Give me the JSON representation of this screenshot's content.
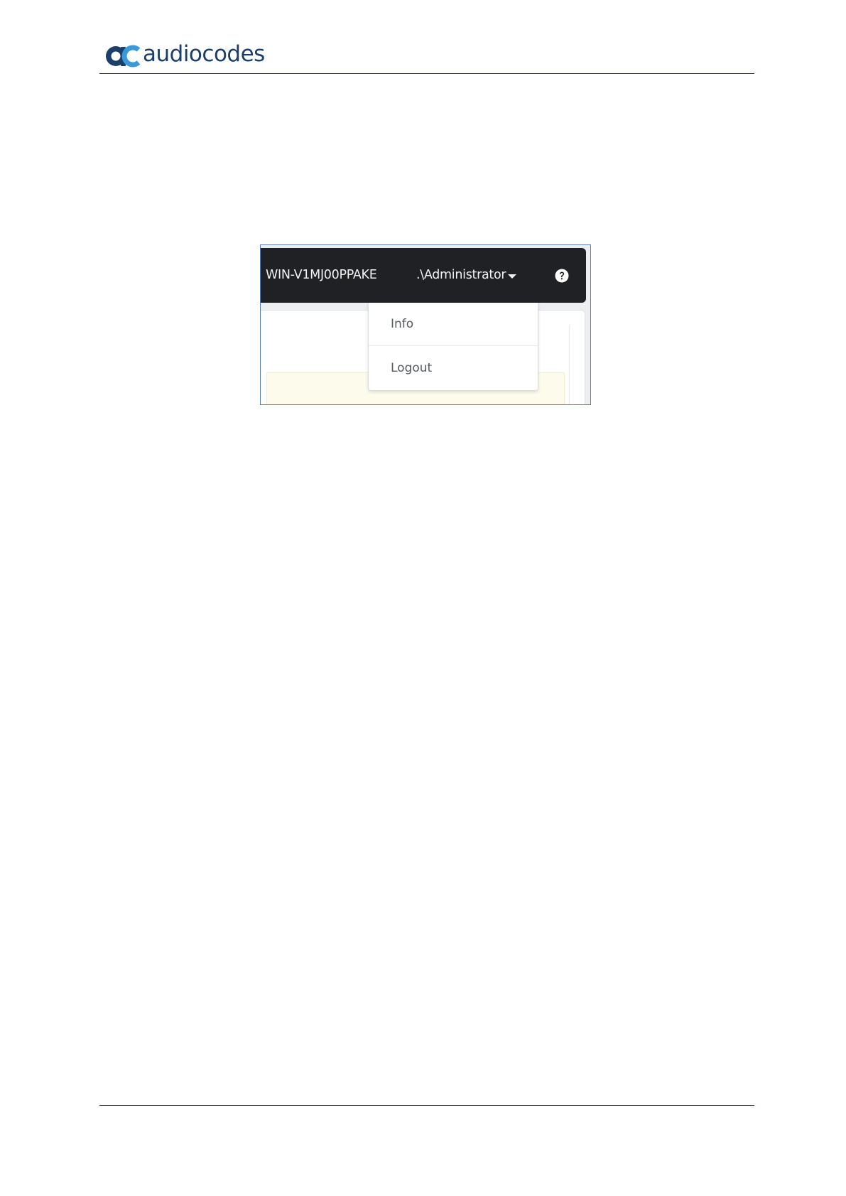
{
  "brand": {
    "logo_text": "audiocodes",
    "logo_mark_icon": "audiocodes-ac-logo-icon",
    "colors": {
      "logo_dark": "#1b3f6b",
      "logo_light": "#3a9ad9",
      "rule": "#27306e"
    }
  },
  "figure": {
    "topbar": {
      "hostname": "WIN-V1MJ00PPAKE",
      "user_menu_label": ".\\Administrator",
      "user_menu_icon": "caret-down-icon",
      "help_icon": "question-circle-icon",
      "background": "#202124"
    },
    "user_menu": {
      "items": [
        {
          "label": "Info"
        },
        {
          "label": "Logout"
        }
      ]
    }
  }
}
